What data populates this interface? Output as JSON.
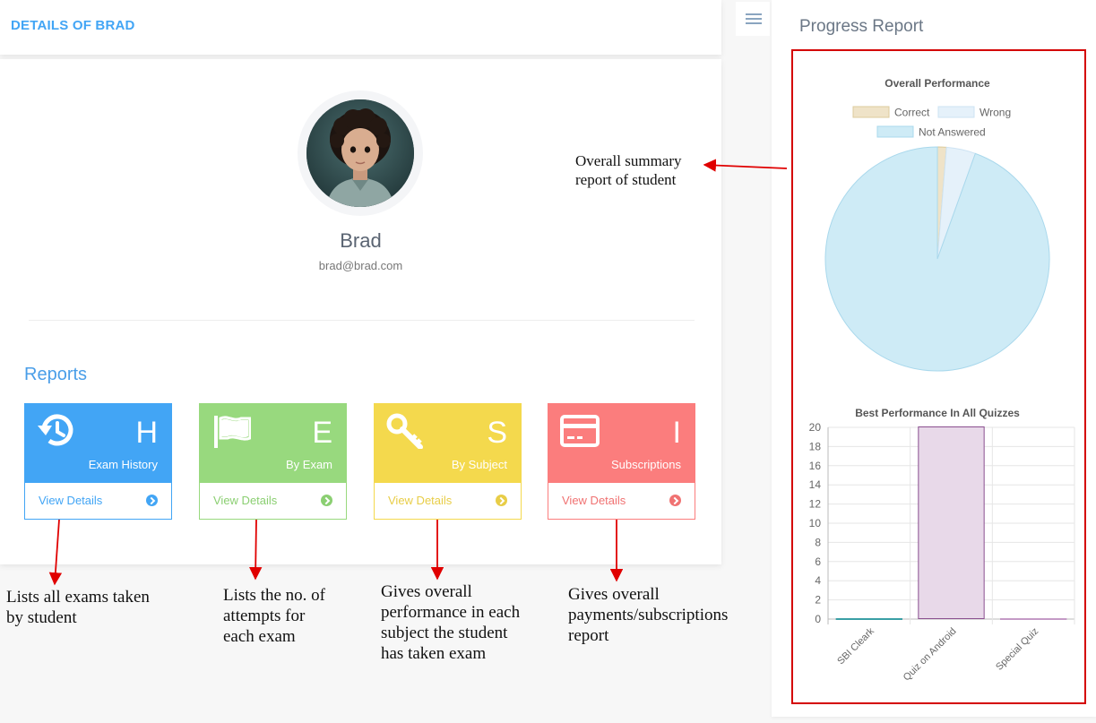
{
  "header": {
    "title": "DETAILS OF BRAD"
  },
  "profile": {
    "name": "Brad",
    "email": "brad@brad.com"
  },
  "reports": {
    "title": "Reports",
    "tiles": [
      {
        "letter": "H",
        "label": "Exam History",
        "link": "View Details",
        "icon": "history-icon",
        "color": "#42a5f5"
      },
      {
        "letter": "E",
        "label": "By Exam",
        "link": "View Details",
        "icon": "flag-icon",
        "color": "#98d97e"
      },
      {
        "letter": "S",
        "label": "By Subject",
        "link": "View Details",
        "icon": "key-icon",
        "color": "#f4d94d"
      },
      {
        "letter": "I",
        "label": "Subscriptions",
        "link": "View Details",
        "icon": "credit-card-icon",
        "color": "#fb7d7d"
      }
    ]
  },
  "annotations": {
    "summary": [
      "Overall summary",
      "report of student"
    ],
    "exam_history": [
      "Lists all exams taken",
      "by student"
    ],
    "by_exam": [
      "Lists the no. of",
      "attempts for",
      "each exam"
    ],
    "by_subject": [
      "Gives overall",
      "performance in each",
      "subject the student",
      "has taken exam"
    ],
    "subscriptions": [
      "Gives overall",
      "payments/subscriptions",
      "report"
    ]
  },
  "progress": {
    "title": "Progress Report",
    "menu_icon": "hamburger-menu-icon"
  },
  "chart_data": [
    {
      "type": "pie",
      "title": "Overall Performance",
      "categories": [
        "Correct",
        "Wrong",
        "Not Answered"
      ],
      "values": [
        1.3,
        4.2,
        94.5
      ],
      "colors": [
        "#efe3c8",
        "#e5f1fa",
        "#ceebf6"
      ],
      "borders": [
        "#dccb9c",
        "#cde3f3",
        "#a9d8ec"
      ],
      "legend": "top"
    },
    {
      "type": "bar",
      "title": "Best Performance In All Quizzes",
      "categories": [
        "SBI Cleark",
        "Quiz on Android",
        "Special Quiz"
      ],
      "values": [
        0,
        20,
        0
      ],
      "colors": [
        "#cfeef0",
        "#e8d9e9",
        "#eeddee"
      ],
      "borders": [
        "#3a9fa5",
        "#8a4f8f",
        "#c49ac6"
      ],
      "ylim": [
        0,
        20
      ],
      "yticks": [
        0,
        2,
        4,
        6,
        8,
        10,
        12,
        14,
        16,
        18,
        20
      ],
      "grid": true
    }
  ]
}
